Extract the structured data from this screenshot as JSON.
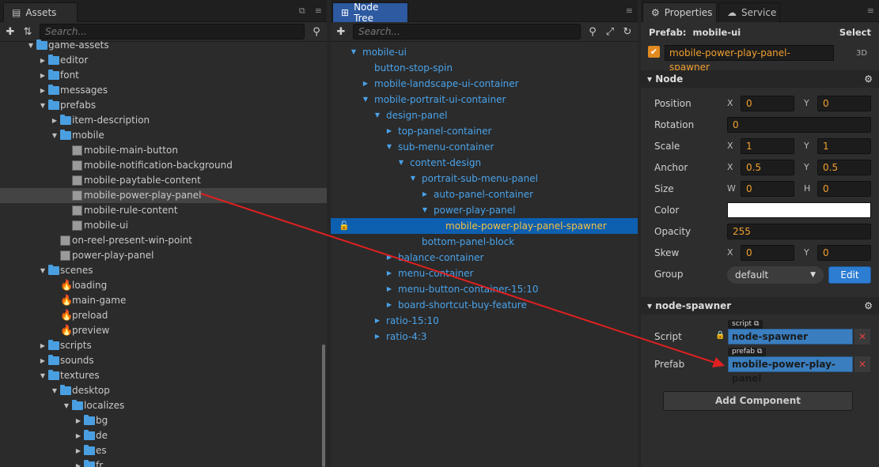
{
  "assets": {
    "tab_label": "Assets",
    "search_placeholder": "Search...",
    "rows": [
      {
        "label": "game-assets",
        "depth": 2,
        "arrow": "down",
        "icon": "folder"
      },
      {
        "label": "editor",
        "depth": 3,
        "arrow": "right",
        "icon": "folder"
      },
      {
        "label": "font",
        "depth": 3,
        "arrow": "right",
        "icon": "folder"
      },
      {
        "label": "messages",
        "depth": 3,
        "arrow": "right",
        "icon": "folder"
      },
      {
        "label": "prefabs",
        "depth": 3,
        "arrow": "down",
        "icon": "folder"
      },
      {
        "label": "item-description",
        "depth": 4,
        "arrow": "right",
        "icon": "folder"
      },
      {
        "label": "mobile",
        "depth": 4,
        "arrow": "down",
        "icon": "folder"
      },
      {
        "label": "mobile-main-button",
        "depth": 5,
        "arrow": "",
        "icon": "cube"
      },
      {
        "label": "mobile-notification-background",
        "depth": 5,
        "arrow": "",
        "icon": "cube"
      },
      {
        "label": "mobile-paytable-content",
        "depth": 5,
        "arrow": "",
        "icon": "cube"
      },
      {
        "label": "mobile-power-play-panel",
        "depth": 5,
        "arrow": "",
        "icon": "cube",
        "selected": true
      },
      {
        "label": "mobile-rule-content",
        "depth": 5,
        "arrow": "",
        "icon": "cube"
      },
      {
        "label": "mobile-ui",
        "depth": 5,
        "arrow": "",
        "icon": "cube"
      },
      {
        "label": "on-reel-present-win-point",
        "depth": 4,
        "arrow": "",
        "icon": "cube"
      },
      {
        "label": "power-play-panel",
        "depth": 4,
        "arrow": "",
        "icon": "cube"
      },
      {
        "label": "scenes",
        "depth": 3,
        "arrow": "down",
        "icon": "folder"
      },
      {
        "label": "loading",
        "depth": 4,
        "arrow": "",
        "icon": "fire"
      },
      {
        "label": "main-game",
        "depth": 4,
        "arrow": "",
        "icon": "fire"
      },
      {
        "label": "preload",
        "depth": 4,
        "arrow": "",
        "icon": "fire"
      },
      {
        "label": "preview",
        "depth": 4,
        "arrow": "",
        "icon": "fire"
      },
      {
        "label": "scripts",
        "depth": 3,
        "arrow": "right",
        "icon": "folder"
      },
      {
        "label": "sounds",
        "depth": 3,
        "arrow": "right",
        "icon": "folder"
      },
      {
        "label": "textures",
        "depth": 3,
        "arrow": "down",
        "icon": "folder"
      },
      {
        "label": "desktop",
        "depth": 4,
        "arrow": "down",
        "icon": "folder"
      },
      {
        "label": "localizes",
        "depth": 5,
        "arrow": "down",
        "icon": "folder"
      },
      {
        "label": "bg",
        "depth": 6,
        "arrow": "right",
        "icon": "folder"
      },
      {
        "label": "de",
        "depth": 6,
        "arrow": "right",
        "icon": "folder"
      },
      {
        "label": "es",
        "depth": 6,
        "arrow": "right",
        "icon": "folder"
      },
      {
        "label": "fr",
        "depth": 6,
        "arrow": "right",
        "icon": "folder"
      }
    ]
  },
  "nodetree": {
    "tab_label": "Node Tree",
    "search_placeholder": "Search...",
    "rows": [
      {
        "label": "mobile-ui",
        "depth": 0,
        "arrow": "down"
      },
      {
        "label": "button-stop-spin",
        "depth": 1,
        "arrow": ""
      },
      {
        "label": "mobile-landscape-ui-container",
        "depth": 1,
        "arrow": "right"
      },
      {
        "label": "mobile-portrait-ui-container",
        "depth": 1,
        "arrow": "down"
      },
      {
        "label": "design-panel",
        "depth": 2,
        "arrow": "down"
      },
      {
        "label": "top-panel-container",
        "depth": 3,
        "arrow": "right"
      },
      {
        "label": "sub-menu-container",
        "depth": 3,
        "arrow": "down"
      },
      {
        "label": "content-design",
        "depth": 4,
        "arrow": "down"
      },
      {
        "label": "portrait-sub-menu-panel",
        "depth": 5,
        "arrow": "down"
      },
      {
        "label": "auto-panel-container",
        "depth": 6,
        "arrow": "right"
      },
      {
        "label": "power-play-panel",
        "depth": 6,
        "arrow": "down"
      },
      {
        "label": "mobile-power-play-panel-spawner",
        "depth": 7,
        "arrow": "",
        "selected": true
      },
      {
        "label": "bottom-panel-block",
        "depth": 5,
        "arrow": ""
      },
      {
        "label": "balance-container",
        "depth": 3,
        "arrow": "right"
      },
      {
        "label": "menu-container",
        "depth": 3,
        "arrow": "right"
      },
      {
        "label": "menu-button-container-15:10",
        "depth": 3,
        "arrow": "right"
      },
      {
        "label": "board-shortcut-buy-feature",
        "depth": 3,
        "arrow": "right"
      },
      {
        "label": "ratio-15:10",
        "depth": 2,
        "arrow": "right"
      },
      {
        "label": "ratio-4:3",
        "depth": 2,
        "arrow": "right"
      }
    ]
  },
  "props": {
    "tab_properties": "Properties",
    "tab_service": "Service",
    "prefab_label": "Prefab:",
    "prefab_name": "mobile-ui",
    "select_label": "Select",
    "node_name": "mobile-power-play-panel-spawner",
    "mode_3d": "3D",
    "node_section": "Node",
    "position_label": "Position",
    "position_x": "0",
    "position_y": "0",
    "rotation_label": "Rotation",
    "rotation": "0",
    "scale_label": "Scale",
    "scale_x": "1",
    "scale_y": "1",
    "anchor_label": "Anchor",
    "anchor_x": "0.5",
    "anchor_y": "0.5",
    "size_label": "Size",
    "size_w": "0",
    "size_h": "0",
    "color_label": "Color",
    "opacity_label": "Opacity",
    "opacity": "255",
    "skew_label": "Skew",
    "skew_x": "0",
    "skew_y": "0",
    "group_label": "Group",
    "group_value": "default",
    "edit_label": "Edit",
    "spawner_section": "node-spawner",
    "script_label": "Script",
    "script_tag": "script",
    "script_value": "node-spawner",
    "prefab_field_label": "Prefab",
    "prefab_tag": "prefab",
    "prefab_value": "mobile-power-play-panel",
    "add_component": "Add Component",
    "ax_x": "X",
    "ax_y": "Y",
    "ax_w": "W",
    "ax_h": "H"
  },
  "colors": {
    "accent": "#2d5aa0",
    "tree_text": "#4aa3ea",
    "value": "#f0a030",
    "arrow": "#e02020"
  }
}
